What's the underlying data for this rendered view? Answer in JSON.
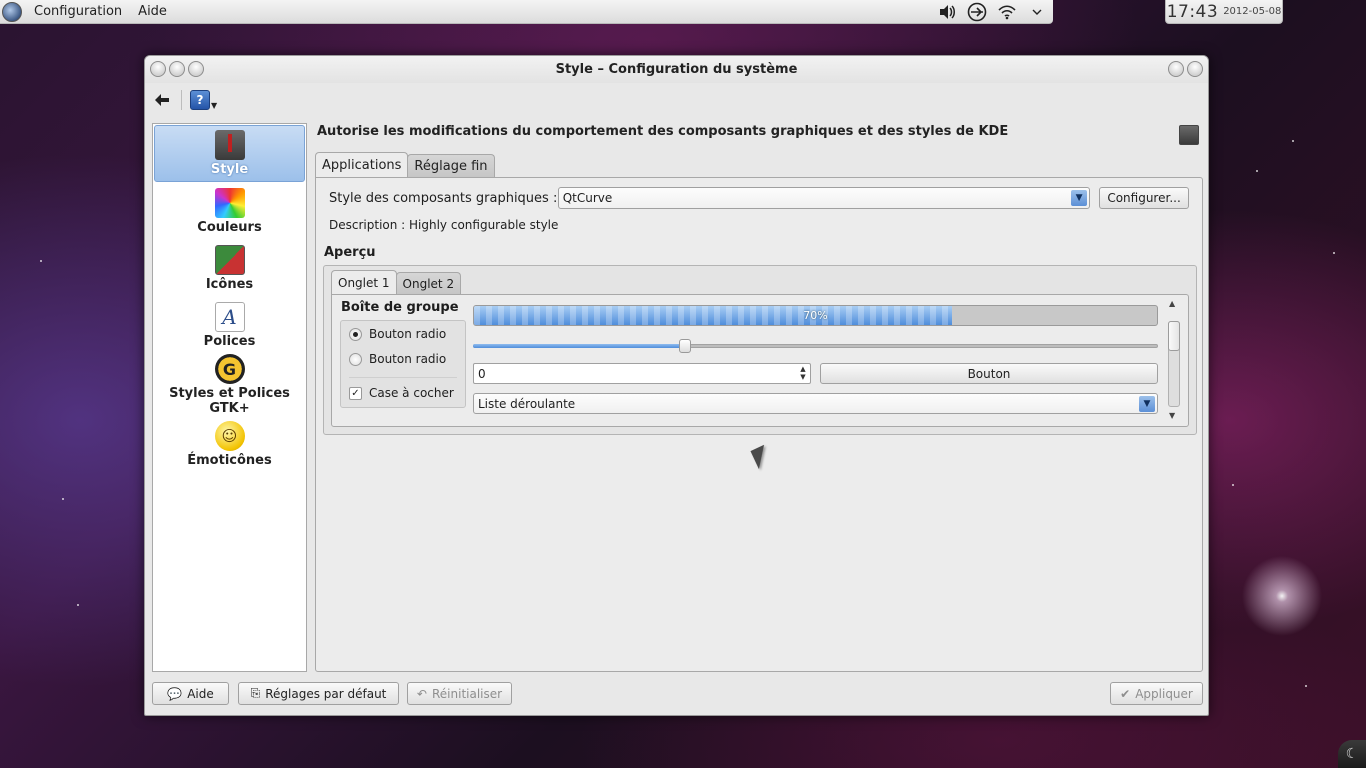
{
  "panel": {
    "menus": [
      "Configuration",
      "Aide"
    ],
    "tray_icons": [
      "volume-icon",
      "network-icon",
      "wifi-icon",
      "chevron-down-icon"
    ],
    "clock": {
      "time": "17:43",
      "date": "2012-05-08"
    }
  },
  "window": {
    "title": "Style – Configuration du système"
  },
  "sidebar": {
    "items": [
      {
        "label": "Style",
        "icon": "tie-icon",
        "selected": true
      },
      {
        "label": "Couleurs",
        "icon": "color-palette-icon",
        "selected": false
      },
      {
        "label": "Icônes",
        "icon": "icons-icon",
        "selected": false
      },
      {
        "label": "Polices",
        "icon": "font-icon",
        "selected": false
      },
      {
        "label": "Styles et Polices GTK+",
        "icon": "gtk-icon",
        "selected": false
      },
      {
        "label": "Émoticônes",
        "icon": "smiley-icon",
        "selected": false
      }
    ]
  },
  "main": {
    "header": "Autorise les modifications du comportement des composants graphiques et des styles de KDE",
    "tabs": [
      {
        "label": "Applications",
        "active": true
      },
      {
        "label": "Réglage fin",
        "active": false
      }
    ],
    "widget_style_label": "Style des composants graphiques :",
    "widget_style_value": "QtCurve",
    "configure_button": "Configurer...",
    "description": "Description : Highly configurable style",
    "preview_label": "Aperçu",
    "preview": {
      "tabs": [
        {
          "label": "Onglet 1",
          "active": true
        },
        {
          "label": "Onglet 2",
          "active": false
        }
      ],
      "groupbox_title": "Boîte de groupe",
      "radio1": "Bouton radio",
      "radio2": "Bouton radio",
      "checkbox": "Case à cocher",
      "progress_value": 0.7,
      "progress_text": "70%",
      "slider_value": 0.31,
      "spin_value": "0",
      "button_label": "Bouton",
      "combo_value": "Liste déroulante"
    }
  },
  "footer": {
    "help": "Aide",
    "defaults": "Réglages par défaut",
    "reset": "Réinitialiser",
    "apply": "Appliquer"
  }
}
